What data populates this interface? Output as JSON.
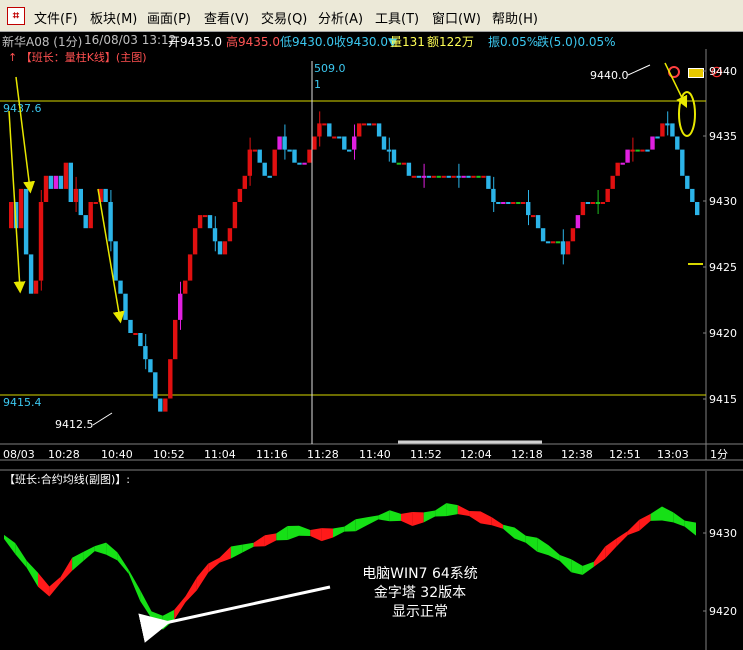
{
  "menu": {
    "items": [
      {
        "label": "文件(F)"
      },
      {
        "label": "板块(M)"
      },
      {
        "label": "画面(P)"
      },
      {
        "label": "查看(V)"
      },
      {
        "label": "交易(Q)"
      },
      {
        "label": "分析(A)"
      },
      {
        "label": "工具(T)"
      },
      {
        "label": "窗口(W)"
      },
      {
        "label": "帮助(H)"
      }
    ]
  },
  "status": {
    "contract": "新华A08 (1分)",
    "datetime": "16/08/03 13:12",
    "open": "开9435.0",
    "high": "高9435.0",
    "low": "低9430.0",
    "close": "收9430.0▼",
    "volume": "量131",
    "amount": "额122万",
    "amplitude": "振0.05%",
    "change": "跌(5.0)0.05%"
  },
  "main_chart": {
    "title": "↑ 【班长：量柱K线】(主图)",
    "y_ticks": [
      "9440",
      "9435",
      "9430",
      "9425",
      "9420",
      "9415"
    ],
    "x_ticks": [
      "08/03",
      "10:28",
      "10:40",
      "10:52",
      "11:04",
      "11:16",
      "11:28",
      "11:40",
      "11:52",
      "12:04",
      "12:18",
      "12:38",
      "12:51",
      "13:03"
    ],
    "timeframe": "1分",
    "hline_upper": "9437.6",
    "hline_lower": "9415.4",
    "label_high": "9440.0",
    "label_low": "9412.5",
    "cursor_value": "509.0",
    "cursor_sub": "1"
  },
  "sub_chart": {
    "title": "【班长:合约均线(副图)】:",
    "y_ticks": [
      "9430",
      "9420"
    ]
  },
  "annotation": {
    "line1": "电脑WIN7 64系统",
    "line2": "金字塔 32版本",
    "line3": "显示正常"
  },
  "chart_data": {
    "type": "candlestick",
    "ylim": [
      9410,
      9442
    ],
    "prices": [
      9428,
      9430,
      9428,
      9431,
      9426,
      9423,
      9424,
      9430,
      9432,
      9431,
      9432,
      9431,
      9433,
      9430,
      9431,
      9429,
      9428,
      9430,
      9430,
      9431,
      9430,
      9427,
      9424,
      9423,
      9421,
      9420,
      9420,
      9419,
      9418,
      9417,
      9415,
      9414,
      9415,
      9418,
      9421,
      9423,
      9424,
      9426,
      9428,
      9429,
      9429,
      9428,
      9427,
      9426,
      9427,
      9428,
      9430,
      9431,
      9432,
      9434,
      9434,
      9433,
      9432,
      9432,
      9434,
      9435,
      9434,
      9434,
      9433,
      9433,
      9433,
      9434,
      9435,
      9436,
      9436,
      9435,
      9435,
      9435,
      9434,
      9434,
      9435,
      9436,
      9436,
      9436,
      9436,
      9435,
      9434,
      9434,
      9433,
      9433,
      9433,
      9432,
      9432,
      9432,
      9432,
      9432,
      9432,
      9432,
      9432,
      9432,
      9432,
      9432,
      9432,
      9432,
      9432,
      9432,
      9432,
      9431,
      9430,
      9430,
      9430,
      9430,
      9430,
      9430,
      9430,
      9429,
      9429,
      9428,
      9427,
      9427,
      9427,
      9427,
      9426,
      9427,
      9428,
      9429,
      9430,
      9430,
      9430,
      9430,
      9430,
      9431,
      9432,
      9433,
      9433,
      9434,
      9434,
      9434,
      9434,
      9434,
      9435,
      9435,
      9436,
      9436,
      9435,
      9434,
      9432,
      9431,
      9430,
      9429
    ],
    "sub_ylim": [
      9417,
      9435
    ],
    "sub_values": [
      9429.5,
      9428,
      9426,
      9424,
      9422.5,
      9424,
      9426,
      9427,
      9428,
      9428,
      9427,
      9425,
      9422,
      9419.5,
      9418.5,
      9419.5,
      9421.5,
      9423.5,
      9425.5,
      9426.5,
      9427.5,
      9428,
      9428.5,
      9429,
      9429.5,
      9430,
      9430.3,
      9430,
      9429.8,
      9430,
      9430.5,
      9431,
      9431.5,
      9432,
      9432.2,
      9432,
      9431.8,
      9432,
      9432.5,
      9433,
      9433,
      9432.5,
      9432,
      9431.5,
      9430.8,
      9430,
      9429.2,
      9428.5,
      9427.8,
      9426.8,
      9425.8,
      9425.2,
      9426,
      9427.5,
      9428.8,
      9430,
      9431,
      9432,
      9432.5,
      9432,
      9431.2,
      9430.5
    ],
    "sub_colors": [
      "g",
      "g",
      "g",
      "r",
      "r",
      "r",
      "g",
      "g",
      "g",
      "g",
      "g",
      "g",
      "g",
      "g",
      "g",
      "r",
      "r",
      "r",
      "r",
      "r",
      "g",
      "g",
      "r",
      "r",
      "g",
      "g",
      "g",
      "r",
      "r",
      "g",
      "g",
      "g",
      "g",
      "g",
      "g",
      "r",
      "r",
      "g",
      "g",
      "g",
      "r",
      "r",
      "r",
      "r",
      "g",
      "g",
      "g",
      "g",
      "g",
      "g",
      "g",
      "g",
      "r",
      "r",
      "r",
      "r",
      "r",
      "g",
      "g",
      "g",
      "g",
      "g"
    ]
  }
}
